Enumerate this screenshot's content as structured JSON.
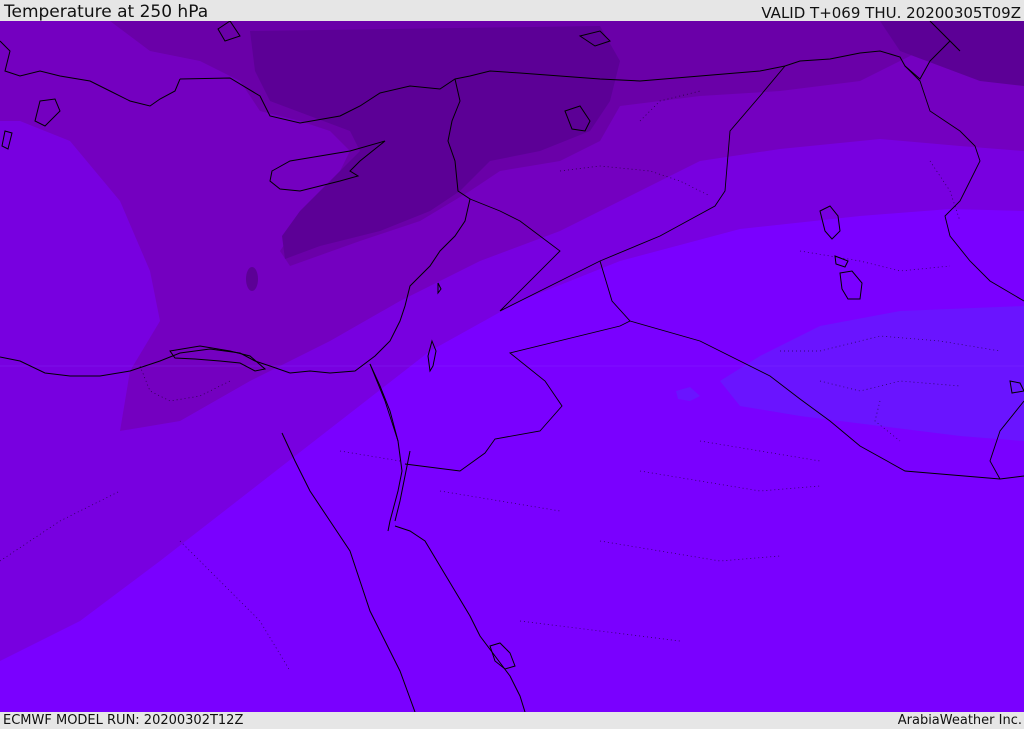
{
  "header": {
    "title": "Temperature at 250 hPa",
    "valid_time": "VALID T+069 THU. 20200305T09Z"
  },
  "footer": {
    "model_run": "ECMWF MODEL RUN: 20200302T12Z",
    "credit": "ArabiaWeather Inc."
  },
  "colors": {
    "background": "#e6e6e6",
    "coldest": "#5c0096",
    "colder": "#6a00a8",
    "cold": "#7400c0",
    "cool": "#7800e0",
    "mild": "#7a00ff",
    "warmer": "#6a14ff",
    "coastline": "#000000"
  }
}
